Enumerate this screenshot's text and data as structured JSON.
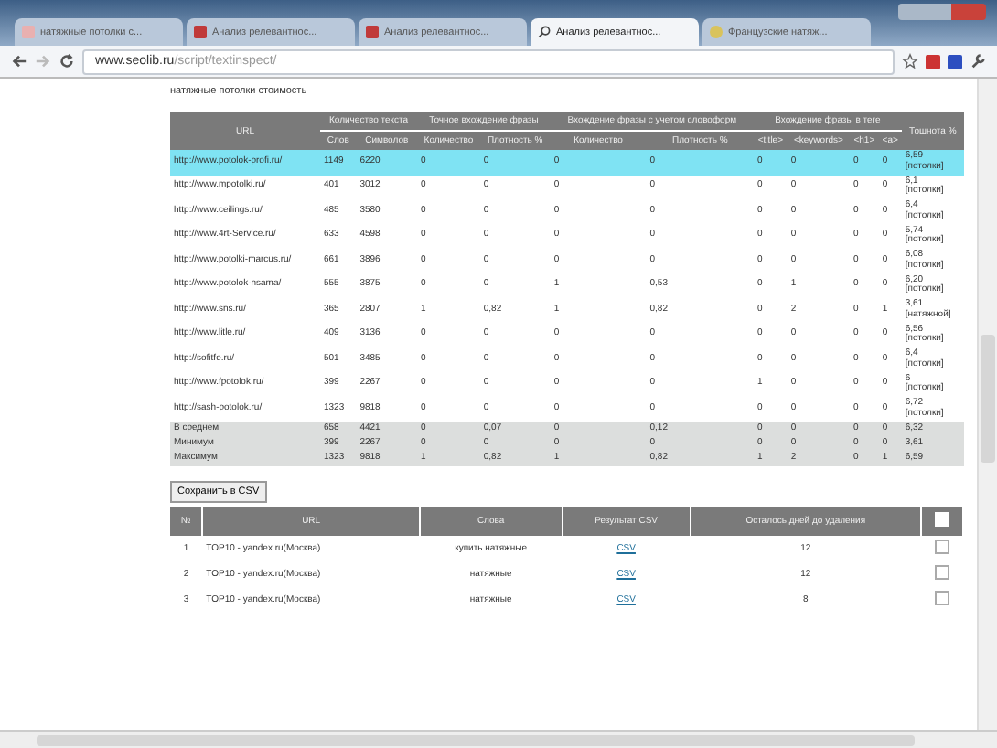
{
  "browser": {
    "tabs": [
      {
        "title": "натяжные потолки с...",
        "selected": false
      },
      {
        "title": "Анализ релевантнос...",
        "selected": false
      },
      {
        "title": "Анализ релевантнос...",
        "selected": false
      },
      {
        "title": "Анализ релевантнос...",
        "selected": true
      },
      {
        "title": "Французские натяж...",
        "selected": false
      }
    ],
    "address": {
      "host": "www.seolib.ru",
      "path": "/script/textinspect/"
    }
  },
  "query": "натяжные потолки стоимость",
  "analysis": {
    "groups": [
      {
        "label": "URL"
      },
      {
        "label": "Количество текста",
        "sub": [
          "Слов",
          "Символов"
        ]
      },
      {
        "label": "Точное вхождение фразы",
        "sub": [
          "Количество",
          "Плотность %"
        ]
      },
      {
        "label": "Вхождение фразы с учетом словоформ",
        "sub": [
          "Количество",
          "Плотность %"
        ]
      },
      {
        "label": "Вхождение фразы в теге",
        "sub": [
          "<title>",
          "<keywords>",
          "<h1>",
          "<a>"
        ]
      },
      {
        "label": "Тошнота %"
      }
    ],
    "rows": [
      {
        "url": "http://www.potolok-profi.ru/",
        "selected": true,
        "cells": [
          "1149",
          "6220",
          "0",
          "0",
          "0",
          "0",
          "0",
          "0",
          "0",
          "0"
        ],
        "nausea": "6,59",
        "word": "[потолки]"
      },
      {
        "url": "http://www.mpotolki.ru/",
        "selected": false,
        "cells": [
          "401",
          "3012",
          "0",
          "0",
          "0",
          "0",
          "0",
          "0",
          "0",
          "0"
        ],
        "nausea": "6,1",
        "word": "[потолки]"
      },
      {
        "url": "http://www.ceilings.ru/",
        "selected": false,
        "cells": [
          "485",
          "3580",
          "0",
          "0",
          "0",
          "0",
          "0",
          "0",
          "0",
          "0"
        ],
        "nausea": "6,4",
        "word": "[потолки]"
      },
      {
        "url": "http://www.4rt-Service.ru/",
        "selected": false,
        "cells": [
          "633",
          "4598",
          "0",
          "0",
          "0",
          "0",
          "0",
          "0",
          "0",
          "0"
        ],
        "nausea": "5,74",
        "word": "[потолки]"
      },
      {
        "url": "http://www.potolki-marcus.ru/",
        "selected": false,
        "cells": [
          "661",
          "3896",
          "0",
          "0",
          "0",
          "0",
          "0",
          "0",
          "0",
          "0"
        ],
        "nausea": "6,08",
        "word": "[потолки]"
      },
      {
        "url": "http://www.potolok-nsama/",
        "selected": false,
        "cells": [
          "555",
          "3875",
          "0",
          "0",
          "1",
          "0,53",
          "0",
          "1",
          "0",
          "0"
        ],
        "nausea": "6,20",
        "word": "[потолки]"
      },
      {
        "url": "http://www.sns.ru/",
        "selected": false,
        "cells": [
          "365",
          "2807",
          "1",
          "0,82",
          "1",
          "0,82",
          "0",
          "2",
          "0",
          "1"
        ],
        "nausea": "3,61",
        "word": "[натяжной]"
      },
      {
        "url": "http://www.litle.ru/",
        "selected": false,
        "cells": [
          "409",
          "3136",
          "0",
          "0",
          "0",
          "0",
          "0",
          "0",
          "0",
          "0"
        ],
        "nausea": "6,56",
        "word": "[потолки]"
      },
      {
        "url": "http://sofitfe.ru/",
        "selected": false,
        "cells": [
          "501",
          "3485",
          "0",
          "0",
          "0",
          "0",
          "0",
          "0",
          "0",
          "0"
        ],
        "nausea": "6,4",
        "word": "[потолки]"
      },
      {
        "url": "http://www.fpotolok.ru/",
        "selected": false,
        "cells": [
          "399",
          "2267",
          "0",
          "0",
          "0",
          "0",
          "1",
          "0",
          "0",
          "0"
        ],
        "nausea": "6",
        "word": "[потолки]"
      },
      {
        "url": "http://sash-potolok.ru/",
        "selected": false,
        "cells": [
          "1323",
          "9818",
          "0",
          "0",
          "0",
          "0",
          "0",
          "0",
          "0",
          "0"
        ],
        "nausea": "6,72",
        "word": "[потолки]"
      }
    ],
    "summary": [
      {
        "label": "В среднем",
        "cells": [
          "658",
          "4421",
          "0",
          "0,07",
          "0",
          "0,12",
          "0",
          "0",
          "0",
          "0",
          "6,32"
        ]
      },
      {
        "label": "Минимум",
        "cells": [
          "399",
          "2267",
          "0",
          "0",
          "0",
          "0",
          "0",
          "0",
          "0",
          "0",
          "3,61"
        ]
      },
      {
        "label": "Максимум",
        "cells": [
          "1323",
          "9818",
          "1",
          "0,82",
          "1",
          "0,82",
          "1",
          "2",
          "0",
          "1",
          "6,59"
        ]
      }
    ]
  },
  "save_button": "Сохранить в CSV",
  "history": {
    "columns": [
      "№",
      "URL",
      "Слова",
      "Результат CSV",
      "Осталось дней до удаления"
    ],
    "all_checked": false,
    "rows": [
      {
        "num": "1",
        "url": "TOP10 - yandex.ru(Москва)",
        "words": "купить натяжные",
        "csv": "CSV",
        "days": "12",
        "checked": false
      },
      {
        "num": "2",
        "url": "TOP10 - yandex.ru(Москва)",
        "words": "натяжные",
        "csv": "CSV",
        "days": "12",
        "checked": false
      },
      {
        "num": "3",
        "url": "TOP10 - yandex.ru(Москва)",
        "words": "натяжные",
        "csv": "CSV",
        "days": "8",
        "checked": false
      }
    ]
  }
}
